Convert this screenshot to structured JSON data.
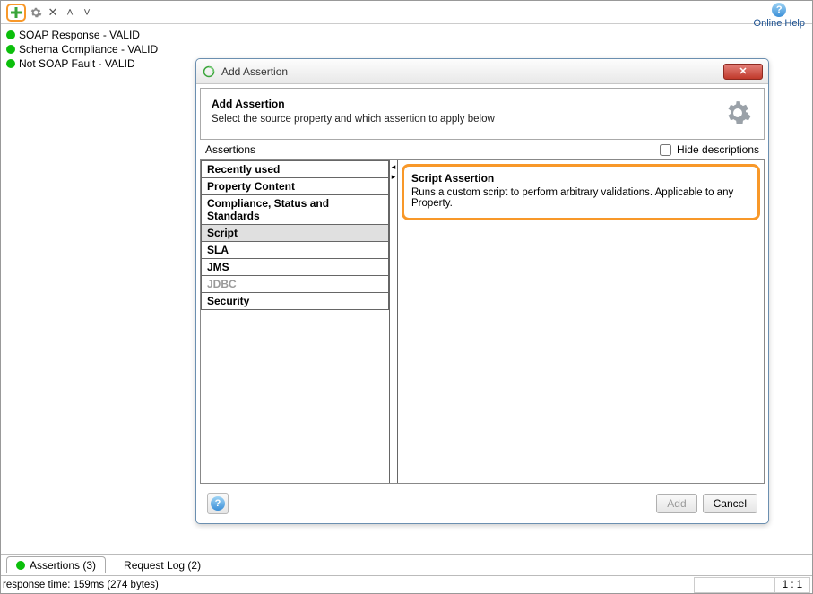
{
  "toolbar": {
    "help_label": "Online Help"
  },
  "sidebar": {
    "items": [
      {
        "label": "SOAP Response - VALID"
      },
      {
        "label": "Schema Compliance - VALID"
      },
      {
        "label": "Not SOAP Fault - VALID"
      }
    ]
  },
  "dialog": {
    "window_title": "Add Assertion",
    "header_title": "Add Assertion",
    "header_subtitle": "Select the source property and which assertion to apply below",
    "assertions_label": "Assertions",
    "hide_descriptions_label": "Hide descriptions",
    "categories": [
      {
        "label": "Recently used"
      },
      {
        "label": "Property Content"
      },
      {
        "label": "Compliance, Status and Standards"
      },
      {
        "label": "Script",
        "selected": true
      },
      {
        "label": "SLA"
      },
      {
        "label": "JMS"
      },
      {
        "label": "JDBC",
        "disabled": true
      },
      {
        "label": "Security"
      }
    ],
    "detail": {
      "title": "Script Assertion",
      "desc": "Runs a custom script to perform arbitrary validations. Applicable to any Property."
    },
    "buttons": {
      "add": "Add",
      "cancel": "Cancel"
    }
  },
  "tabs": {
    "assertions": "Assertions (3)",
    "request_log": "Request Log (2)"
  },
  "status": {
    "left": "response time: 159ms (274 bytes)",
    "ratio": "1 : 1"
  }
}
